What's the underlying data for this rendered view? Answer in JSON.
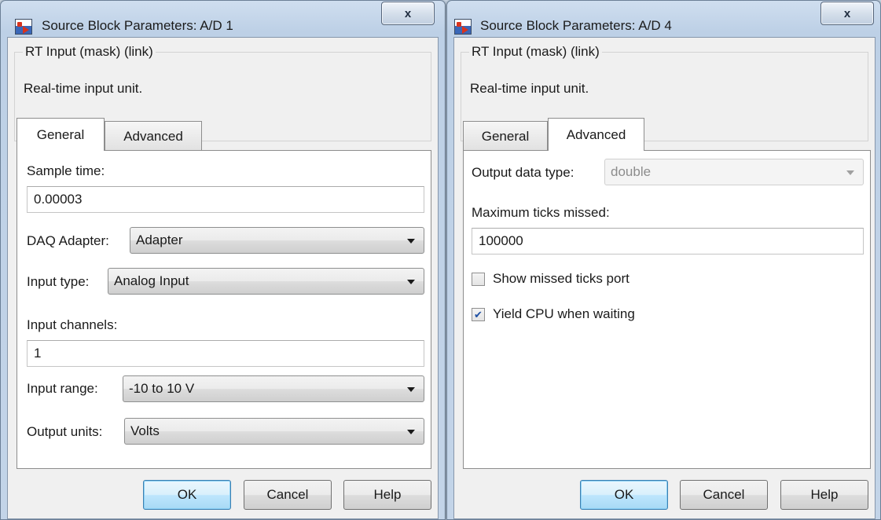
{
  "dialog_left": {
    "title": "Source Block Parameters: A/D 1",
    "close_label": "x",
    "group_title": "RT Input (mask) (link)",
    "group_desc": "Real-time input unit.",
    "tabs": [
      {
        "label": "General",
        "active": true
      },
      {
        "label": "Advanced",
        "active": false
      }
    ],
    "fields": {
      "sample_time_label": "Sample time:",
      "sample_time_value": "0.00003",
      "daq_adapter_label": "DAQ Adapter:",
      "daq_adapter_value": "Adapter",
      "input_type_label": "Input type:",
      "input_type_value": "Analog Input",
      "input_channels_label": "Input channels:",
      "input_channels_value": "1",
      "input_range_label": "Input range:",
      "input_range_value": "-10 to 10 V",
      "output_units_label": "Output units:",
      "output_units_value": "Volts"
    },
    "buttons": {
      "ok": "OK",
      "cancel": "Cancel",
      "help": "Help"
    }
  },
  "dialog_right": {
    "title": "Source Block Parameters: A/D 4",
    "close_label": "x",
    "group_title": "RT Input (mask) (link)",
    "group_desc": "Real-time input unit.",
    "tabs": [
      {
        "label": "General",
        "active": false
      },
      {
        "label": "Advanced",
        "active": true
      }
    ],
    "fields": {
      "output_data_type_label": "Output data type:",
      "output_data_type_value": "double",
      "max_ticks_label": "Maximum ticks missed:",
      "max_ticks_value": "100000",
      "show_missed_label": "Show missed ticks port",
      "show_missed_checked": false,
      "yield_cpu_label": "Yield CPU when waiting",
      "yield_cpu_checked": true
    },
    "buttons": {
      "ok": "OK",
      "cancel": "Cancel",
      "help": "Help"
    }
  },
  "colors": {
    "title_bar": "#c3d4e8",
    "client_bg": "#f0f0f0",
    "default_button": "#bee6fd",
    "checkbox_mark": "#1d4fa3"
  }
}
